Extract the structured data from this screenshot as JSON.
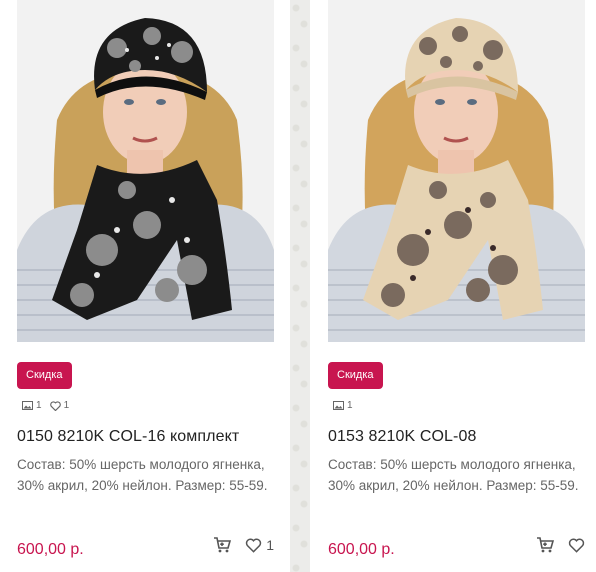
{
  "products": [
    {
      "badge": "Скидка",
      "photos_count": "1",
      "likes_count": "1",
      "title": "0150 8210K COL-16 комплект",
      "description": "Состав: 50% шерсть молодого ягненка, 30% акрил, 20% нейлон. Размер: 55-59.",
      "price": "600,00 р.",
      "wishlist_count": "1",
      "colors": {
        "knit_main": "#1a1a1a",
        "knit_pattern": "#8c8c8c",
        "accent": "#e8e8e8"
      }
    },
    {
      "badge": "Скидка",
      "photos_count": "1",
      "likes_count": "",
      "title": "0153 8210K COL-08",
      "description": "Состав: 50% шерсть молодого ягненка, 30% акрил, 20% нейлон. Размер: 55-59.",
      "price": "600,00 р.",
      "wishlist_count": "",
      "colors": {
        "knit_main": "#e6d3b3",
        "knit_pattern": "#7a6a5e",
        "accent": "#3a2a2a"
      }
    }
  ],
  "icons": {
    "photo": "photo-icon",
    "like": "heart-icon",
    "cart": "cart-icon",
    "wishlist": "heart-icon"
  },
  "theme": {
    "accent": "#c8154f"
  }
}
